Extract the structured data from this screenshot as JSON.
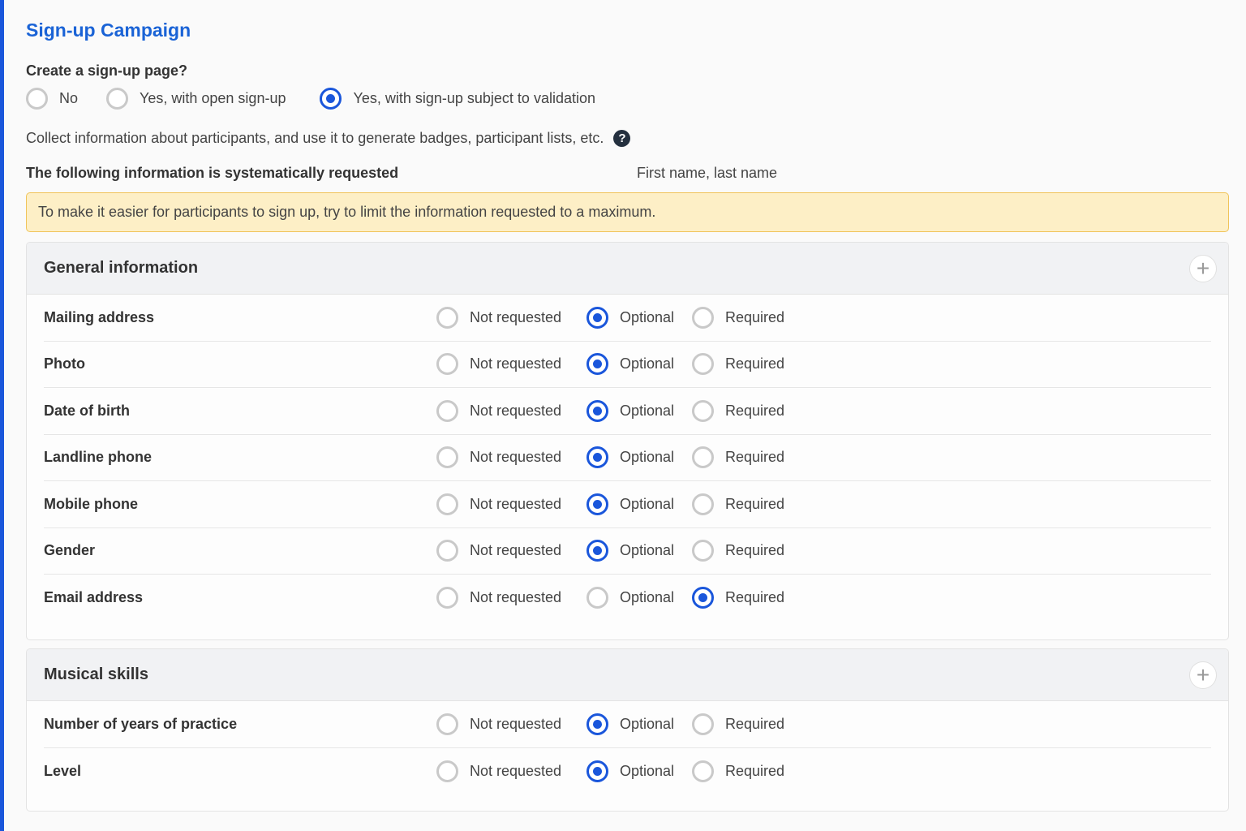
{
  "title": "Sign-up Campaign",
  "signup_question": "Create a sign-up page?",
  "signup_options": [
    {
      "label": "No",
      "selected": false
    },
    {
      "label": "Yes, with open sign-up",
      "selected": false
    },
    {
      "label": "Yes, with sign-up subject to validation",
      "selected": true
    }
  ],
  "collect_text": "Collect information about participants, and use it to generate badges, participant lists, etc.",
  "help_icon": "question-circle-icon",
  "systematic": {
    "label": "The following information is systematically requested",
    "value": "First name, last name"
  },
  "notice": "To make it easier for participants to sign up, try to limit the information requested to a maximum.",
  "choice_labels": [
    "Not requested",
    "Optional",
    "Required"
  ],
  "sections": [
    {
      "title": "General information",
      "add_icon": "plus-icon",
      "fields": [
        {
          "label": "Mailing address",
          "selected": "Optional"
        },
        {
          "label": "Photo",
          "selected": "Optional"
        },
        {
          "label": "Date of birth",
          "selected": "Optional"
        },
        {
          "label": "Landline phone",
          "selected": "Optional"
        },
        {
          "label": "Mobile phone",
          "selected": "Optional"
        },
        {
          "label": "Gender",
          "selected": "Optional"
        },
        {
          "label": "Email address",
          "selected": "Required"
        }
      ]
    },
    {
      "title": "Musical skills",
      "add_icon": "plus-icon",
      "fields": [
        {
          "label": "Number of years of practice",
          "selected": "Optional"
        },
        {
          "label": "Level",
          "selected": "Optional"
        }
      ]
    }
  ],
  "colors": {
    "accent": "#1a56db",
    "title": "#1a63d6",
    "notice_bg": "#fdefc6",
    "notice_border": "#f0c45a"
  }
}
